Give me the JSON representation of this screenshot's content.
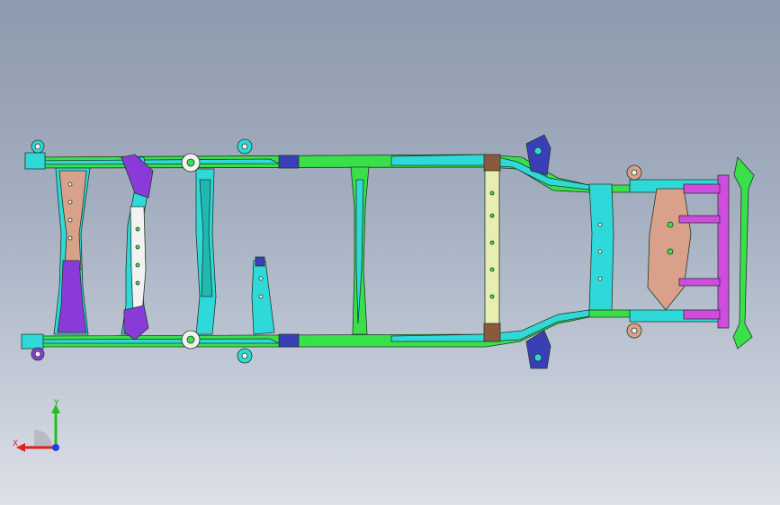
{
  "viewport": {
    "background_top": "#8e9aad",
    "background_bottom": "#dde1e8"
  },
  "model": {
    "colors": {
      "rail_green": "#39e04a",
      "rail_cyan": "#2fd9d9",
      "rail_teal": "#20b9b0",
      "outline": "#1f3a28",
      "magenta": "#d24be0",
      "violet": "#8a3ad8",
      "navy": "#3a3fb8",
      "tan": "#d9a08a",
      "pale_yellow": "#e8eeb0",
      "brown": "#8b5a3c",
      "white": "#f2f2f2"
    }
  },
  "triad": {
    "x_label": "X",
    "y_label": "Y",
    "x_color": "#e02020",
    "y_color": "#20c020",
    "z_color": "#2040e0"
  }
}
